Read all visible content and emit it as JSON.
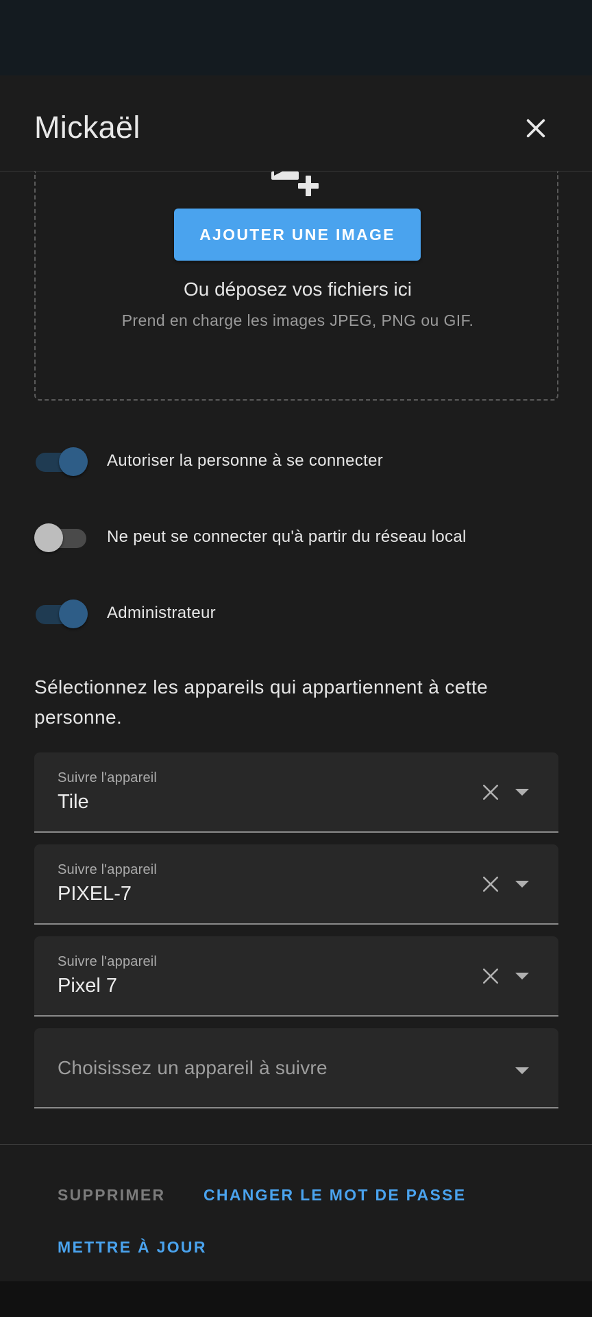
{
  "dialog": {
    "title": "Mickaël"
  },
  "upload": {
    "button_label": "AJOUTER UNE IMAGE",
    "drop_text": "Ou déposez vos fichiers ici",
    "hint": "Prend en charge les images JPEG, PNG ou GIF."
  },
  "toggles": [
    {
      "label": "Autoriser la personne à se connecter",
      "checked": true
    },
    {
      "label": "Ne peut se connecter qu'à partir du réseau local",
      "checked": false
    },
    {
      "label": "Administrateur",
      "checked": true
    }
  ],
  "devices": {
    "description": "Sélectionnez les appareils qui appartiennent à cette personne.",
    "field_label": "Suivre l'appareil",
    "items": [
      {
        "value": "Tile"
      },
      {
        "value": "PIXEL-7"
      },
      {
        "value": "Pixel 7"
      }
    ],
    "add_placeholder": "Choisissez un appareil à suivre"
  },
  "footer": {
    "delete_label": "SUPPRIMER",
    "change_password_label": "CHANGER LE MOT DE PASSE",
    "update_label": "METTRE À JOUR"
  },
  "colors": {
    "accent": "#4aa3ee",
    "dialog_bg": "#1c1c1c",
    "switch_on": "#2e5d87"
  }
}
